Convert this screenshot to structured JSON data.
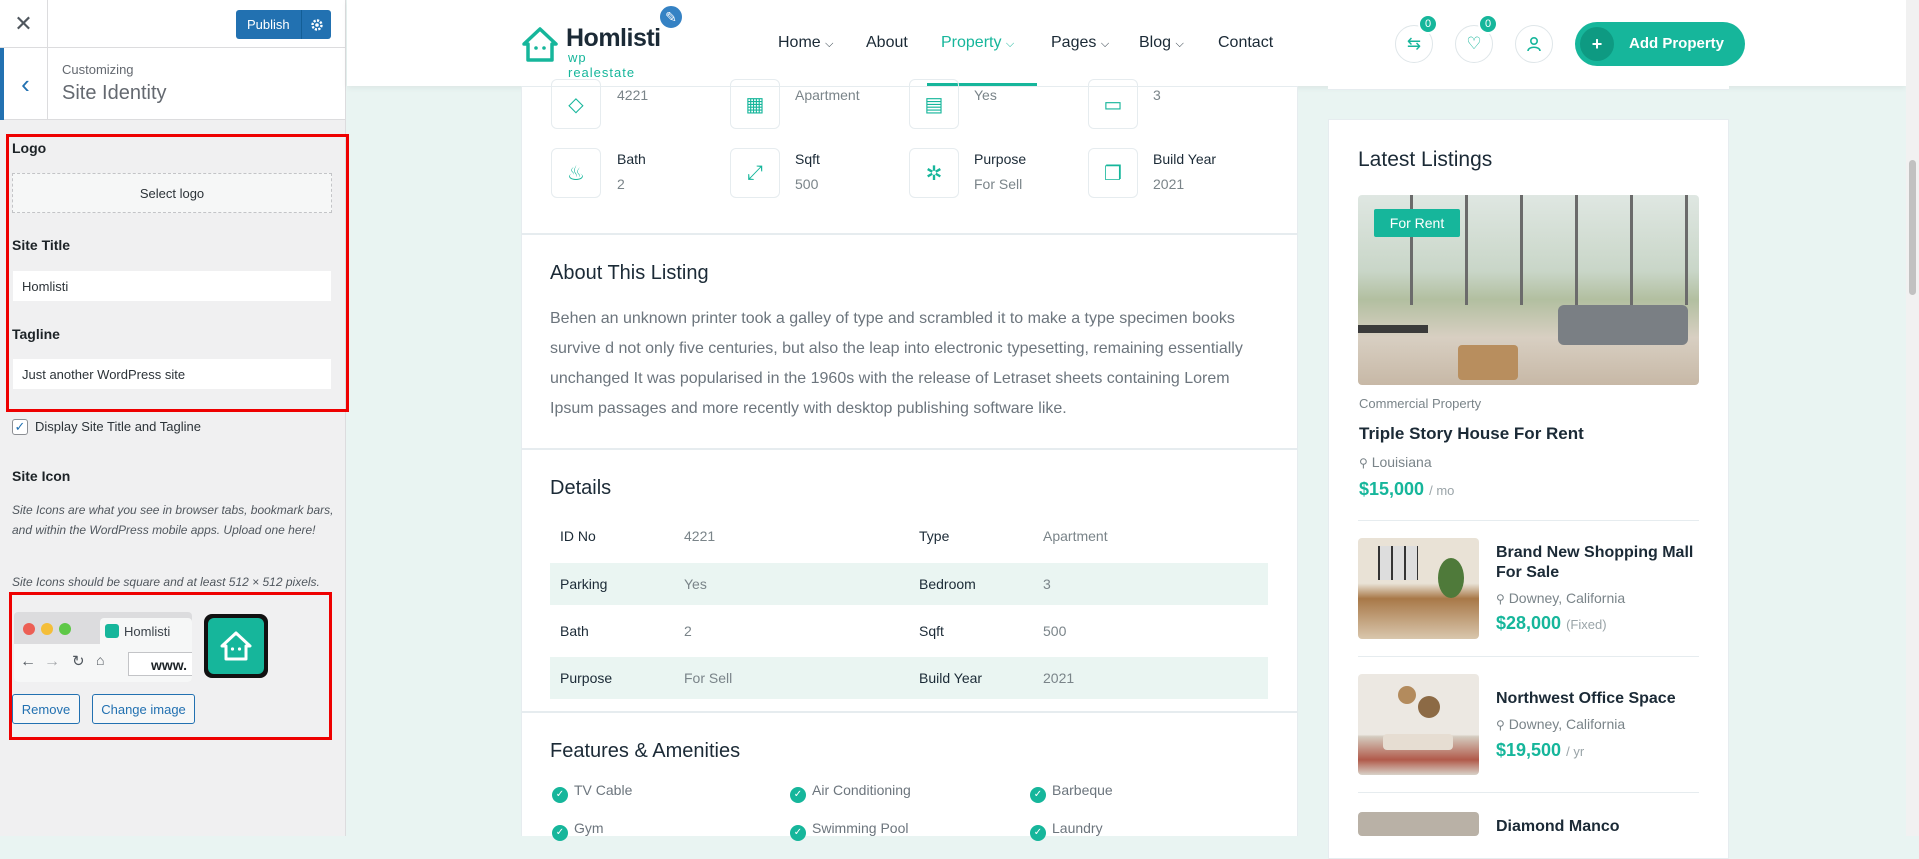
{
  "customizer": {
    "publish_label": "Publish",
    "section_sub": "Customizing",
    "section_title": "Site Identity",
    "logo_label": "Logo",
    "select_logo": "Select logo",
    "site_title_label": "Site Title",
    "site_title_value": "Homlisti",
    "tagline_label": "Tagline",
    "tagline_value": "Just another WordPress site",
    "display_checkbox_label": "Display Site Title and Tagline",
    "site_icon_label": "Site Icon",
    "site_icon_desc1": "Site Icons are what you see in browser tabs, bookmark bars, and within the WordPress mobile apps. Upload one here!",
    "site_icon_desc2": "Site Icons should be square and at least 512 × 512 pixels.",
    "preview_tab": "Homlisti",
    "preview_url": "www.",
    "remove_label": "Remove",
    "change_image_label": "Change image"
  },
  "header": {
    "logo_name": "Homlisti",
    "logo_tag": "wp realestate",
    "nav": [
      "Home",
      "About",
      "Property",
      "Pages",
      "Blog",
      "Contact"
    ],
    "compare_count": "0",
    "wishlist_count": "0",
    "add_property": "Add Property"
  },
  "features_top": {
    "v1": "4221",
    "v2": "Apartment",
    "v3": "Yes",
    "v4": "3"
  },
  "features": [
    {
      "label": "Bath",
      "value": "2"
    },
    {
      "label": "Sqft",
      "value": "500"
    },
    {
      "label": "Purpose",
      "value": "For Sell"
    },
    {
      "label": "Build Year",
      "value": "2021"
    }
  ],
  "about": {
    "title": "About This Listing",
    "text": "Behen an unknown printer took a galley of type and scrambled it to make a type specimen books survive d not only five centuries, but also the leap into electronic typesetting, remaining essentially unchanged It was popularised in the 1960s with the release of Letraset sheets containing Lorem Ipsum passages and more recently with desktop publishing software like."
  },
  "details": {
    "title": "Details",
    "rows": [
      {
        "k1": "ID No",
        "v1": "4221",
        "k2": "Type",
        "v2": "Apartment"
      },
      {
        "k1": "Parking",
        "v1": "Yes",
        "k2": "Bedroom",
        "v2": "3"
      },
      {
        "k1": "Bath",
        "v1": "2",
        "k2": "Sqft",
        "v2": "500"
      },
      {
        "k1": "Purpose",
        "v1": "For Sell",
        "k2": "Build Year",
        "v2": "2021"
      }
    ]
  },
  "amenities": {
    "title": "Features & Amenities",
    "items": [
      "TV Cable",
      "Air Conditioning",
      "Barbeque",
      "Gym",
      "Swimming Pool",
      "Laundry"
    ]
  },
  "latest": {
    "title": "Latest Listings",
    "featured": {
      "badge": "For Rent",
      "category": "Commercial Property",
      "name": "Triple Story House For Rent",
      "location": "Louisiana",
      "price": "$15,000",
      "period": "/ mo"
    },
    "items": [
      {
        "name": "Brand New Shopping Mall For Sale",
        "location": "Downey, California",
        "price": "$28,000",
        "period": "(Fixed)"
      },
      {
        "name": "Northwest Office Space",
        "location": "Downey, California",
        "price": "$19,500",
        "period": "/ yr"
      },
      {
        "name": "Diamond Manco",
        "location": "",
        "price": "",
        "period": ""
      }
    ]
  },
  "colors": {
    "accent": "#16b69b",
    "wp_blue": "#2271b1",
    "highlight": "#e00000"
  }
}
